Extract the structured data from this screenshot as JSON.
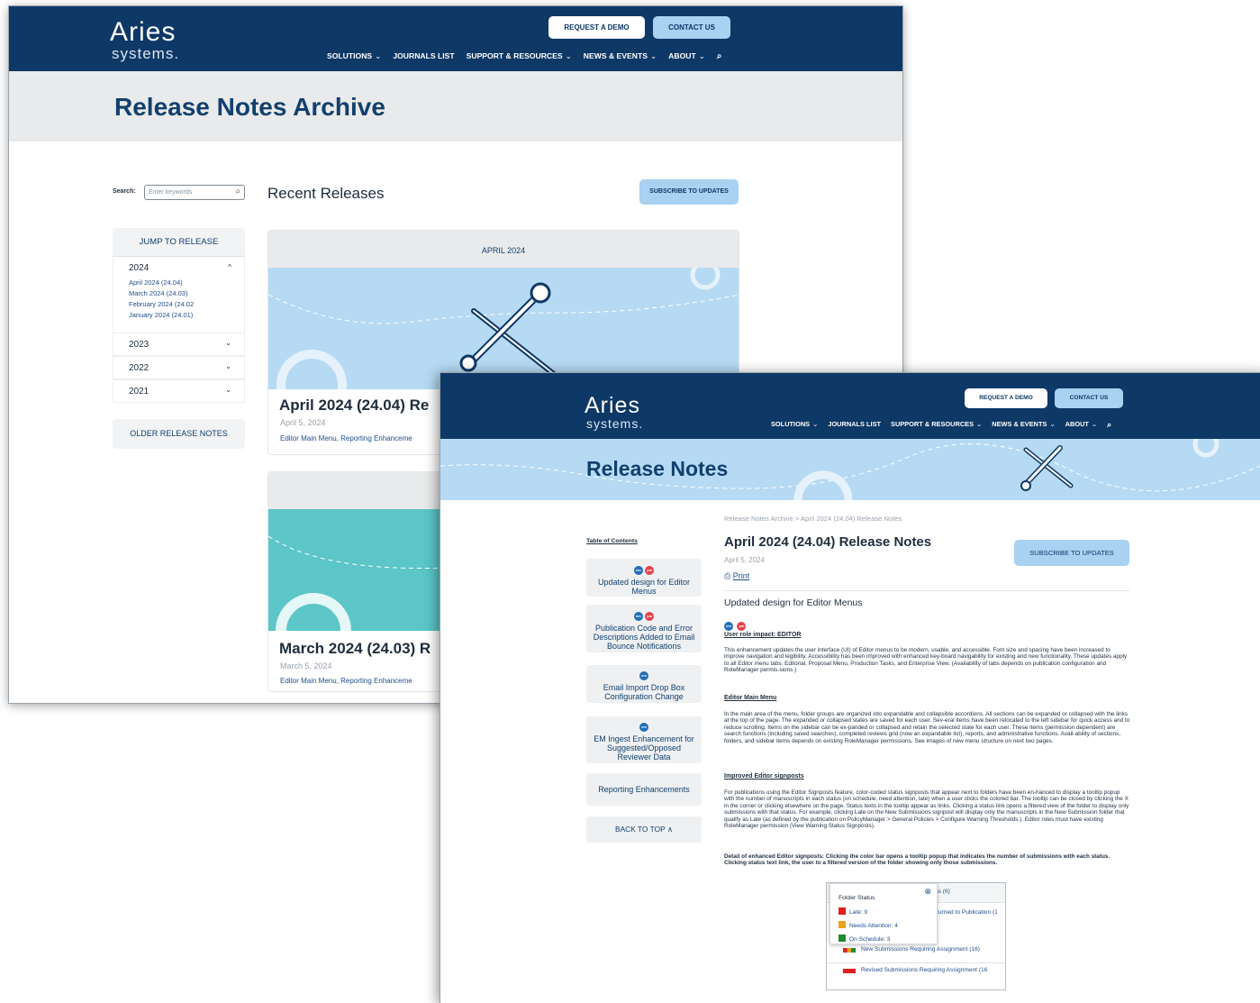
{
  "archive": {
    "logo": {
      "name": "Aries",
      "sub": "systems."
    },
    "request_demo": "REQUEST A DEMO",
    "contact": "CONTACT US",
    "menu": [
      {
        "label": "SOLUTIONS",
        "chev": "⌄"
      },
      {
        "label": "JOURNALS LIST",
        "chev": ""
      },
      {
        "label": "SUPPORT & RESOURCES",
        "chev": "⌄"
      },
      {
        "label": "NEWS & EVENTS",
        "chev": "⌄"
      },
      {
        "label": "ABOUT",
        "chev": "⌄"
      }
    ],
    "page_title": "Release Notes Archive",
    "search_label": "Search:",
    "search_placeholder": "Enter keywords",
    "recent_heading": "Recent Releases",
    "subscribe": "SUBSCRIBE TO UPDATES",
    "jump_heading": "JUMP TO RELEASE",
    "years": [
      {
        "year": "2024",
        "chev": "^",
        "links": [
          "April 2024 (24.04)",
          "March 2024 (24.03)",
          "February 2024 (24.02",
          "January 2024 (24.01)"
        ]
      },
      {
        "year": "2023",
        "chev": "⌄"
      },
      {
        "year": "2022",
        "chev": "⌄"
      },
      {
        "year": "2021",
        "chev": "⌄"
      }
    ],
    "older": "OLDER RELEASE NOTES",
    "cards": [
      {
        "month": "APRIL 2024",
        "title": "April 2024 (24.04) Re",
        "date": "April 5, 2024",
        "links": "Editor Main Menu, Reporting Enhanceme"
      },
      {
        "month": "",
        "title": "March 2024 (24.03) R",
        "date": "March 5, 2024",
        "links": "Editor Main Menu, Reporting Enhanceme"
      }
    ],
    "colors": {
      "nav": "#0e3866",
      "band": "#e9eaeb",
      "card1": "#b6daf3",
      "card2": "#5cc6c8"
    }
  },
  "notes": {
    "logo": {
      "name": "Aries",
      "sub": "systems."
    },
    "request_demo": "REQUEST A DEMO",
    "contact": "CONTACT US",
    "menu": [
      {
        "label": "SOLUTIONS",
        "chev": "⌄"
      },
      {
        "label": "JOURNALS LIST",
        "chev": ""
      },
      {
        "label": "SUPPORT & RESOURCES",
        "chev": "⌄"
      },
      {
        "label": "NEWS & EVENTS",
        "chev": "⌄"
      },
      {
        "label": "ABOUT",
        "chev": "⌄"
      }
    ],
    "page_title": "Release Notes",
    "breadcrumb": "Release Notes Archive > April 2024 (24.04) Release Notes",
    "toc_title": "Table of Contents",
    "toc": [
      {
        "label": "Updated design for Editor Menus",
        "badges": [
          "em",
          "pm"
        ]
      },
      {
        "label": "Publication Code and Error Descriptions Added to Email Bounce Notifications",
        "badges": [
          "em",
          "pm"
        ]
      },
      {
        "label": "Email Import Drop Box Configuration Change",
        "badges": [
          "em"
        ]
      },
      {
        "label": "EM Ingest Enhancement for Suggested/Opposed Reviewer Data",
        "badges": [
          "em"
        ]
      },
      {
        "label": "Reporting Enhancements",
        "badges": []
      }
    ],
    "back_to_top": "BACK TO TOP",
    "heading": "April 2024 (24.04) Release Notes",
    "date": "April 5, 2024",
    "print": "Print",
    "subscribe": "SUBSCRIBE TO UPDATES",
    "section_title": "Updated design for Editor Menus",
    "role_impact": "User role impact: EDITOR",
    "p1": "This enhancement updates the user interface (UI) of Editor menus to be modern, usable, and accessible. Font size and spacing have been increased to improve navigation and legibility. Accessibility has been improved with enhanced key-board navigability for existing and new functionality. These updates apply to all Editor menu tabs: Editorial, Proposal Menu, Production Tasks, and Enterprise View. (Availability of tabs depends on publication configuration and RoleManager permis-sions.)",
    "h_main_menu": "Editor Main Menu",
    "p2": "In the main area of the menu, folder groups are organized into expandable and collapsible accordions. All sections can be expanded or collapsed with the links at the top of the page. The expanded or collapsed states are saved for each user. Sev-eral items have been relocated to the left sidebar for quick access and to reduce scrolling. Items on the sidebar can be ex-panded or collapsed and retain the selected state for each user. These items (permission dependent) are search functions (including saved searches), completed reviews grid (now an expandable list), reports, and administrative functions. Avail-ability of sections, folders, and sidebar items depends on existing RoleManager permissions. See images of new menu structure on next two pages.",
    "h_signposts": "Improved Editor signposts",
    "p3": "For publications using the Editor Signposts feature, color-coded status signposts that appear next to folders have been en-hanced to display a tooltip popup with the number of manuscripts in each status (on schedule, need attention, late) when a user clicks the colored bar. The tooltip can be closed by clicking the X in the corner or clicking elsewhere on the page. Status texts in the tooltip appear as links. Clicking a status link opens a filtered view of the folder to display only submissions with that status. For example, clicking Late on the New Submissions signpost will display only the manuscripts in the New Submission folder that qualify as Late (as defined by the publication on PolicyManager > General Policies > Configure Warning Thresholds.). Editor roles must have existing RoleManager permission (View Warning Status Signposts).",
    "p4": "Detail of enhanced Editor signposts: Clicking the color bar opens a tooltip popup that indicates the number of submissions with each status. Clicking status text link, the user to a filtered version of the folder showing only those submissions.",
    "tooltip": {
      "title": "Folder Status",
      "items": [
        {
          "label": "Late: 9",
          "color": "#e02020"
        },
        {
          "label": "Needs Attention: 4",
          "color": "#f0a020"
        },
        {
          "label": "On Schedule: 3",
          "color": "#1e8c2a"
        }
      ],
      "bg_rows": [
        "ns (6)",
        "turned to Publication (1",
        "New Submissions Requiring Assignment (16)",
        "Revised Submissions Requiring Assignment (16"
      ]
    },
    "colors": {
      "nav": "#0e3866",
      "hero": "#b6daf3"
    }
  }
}
